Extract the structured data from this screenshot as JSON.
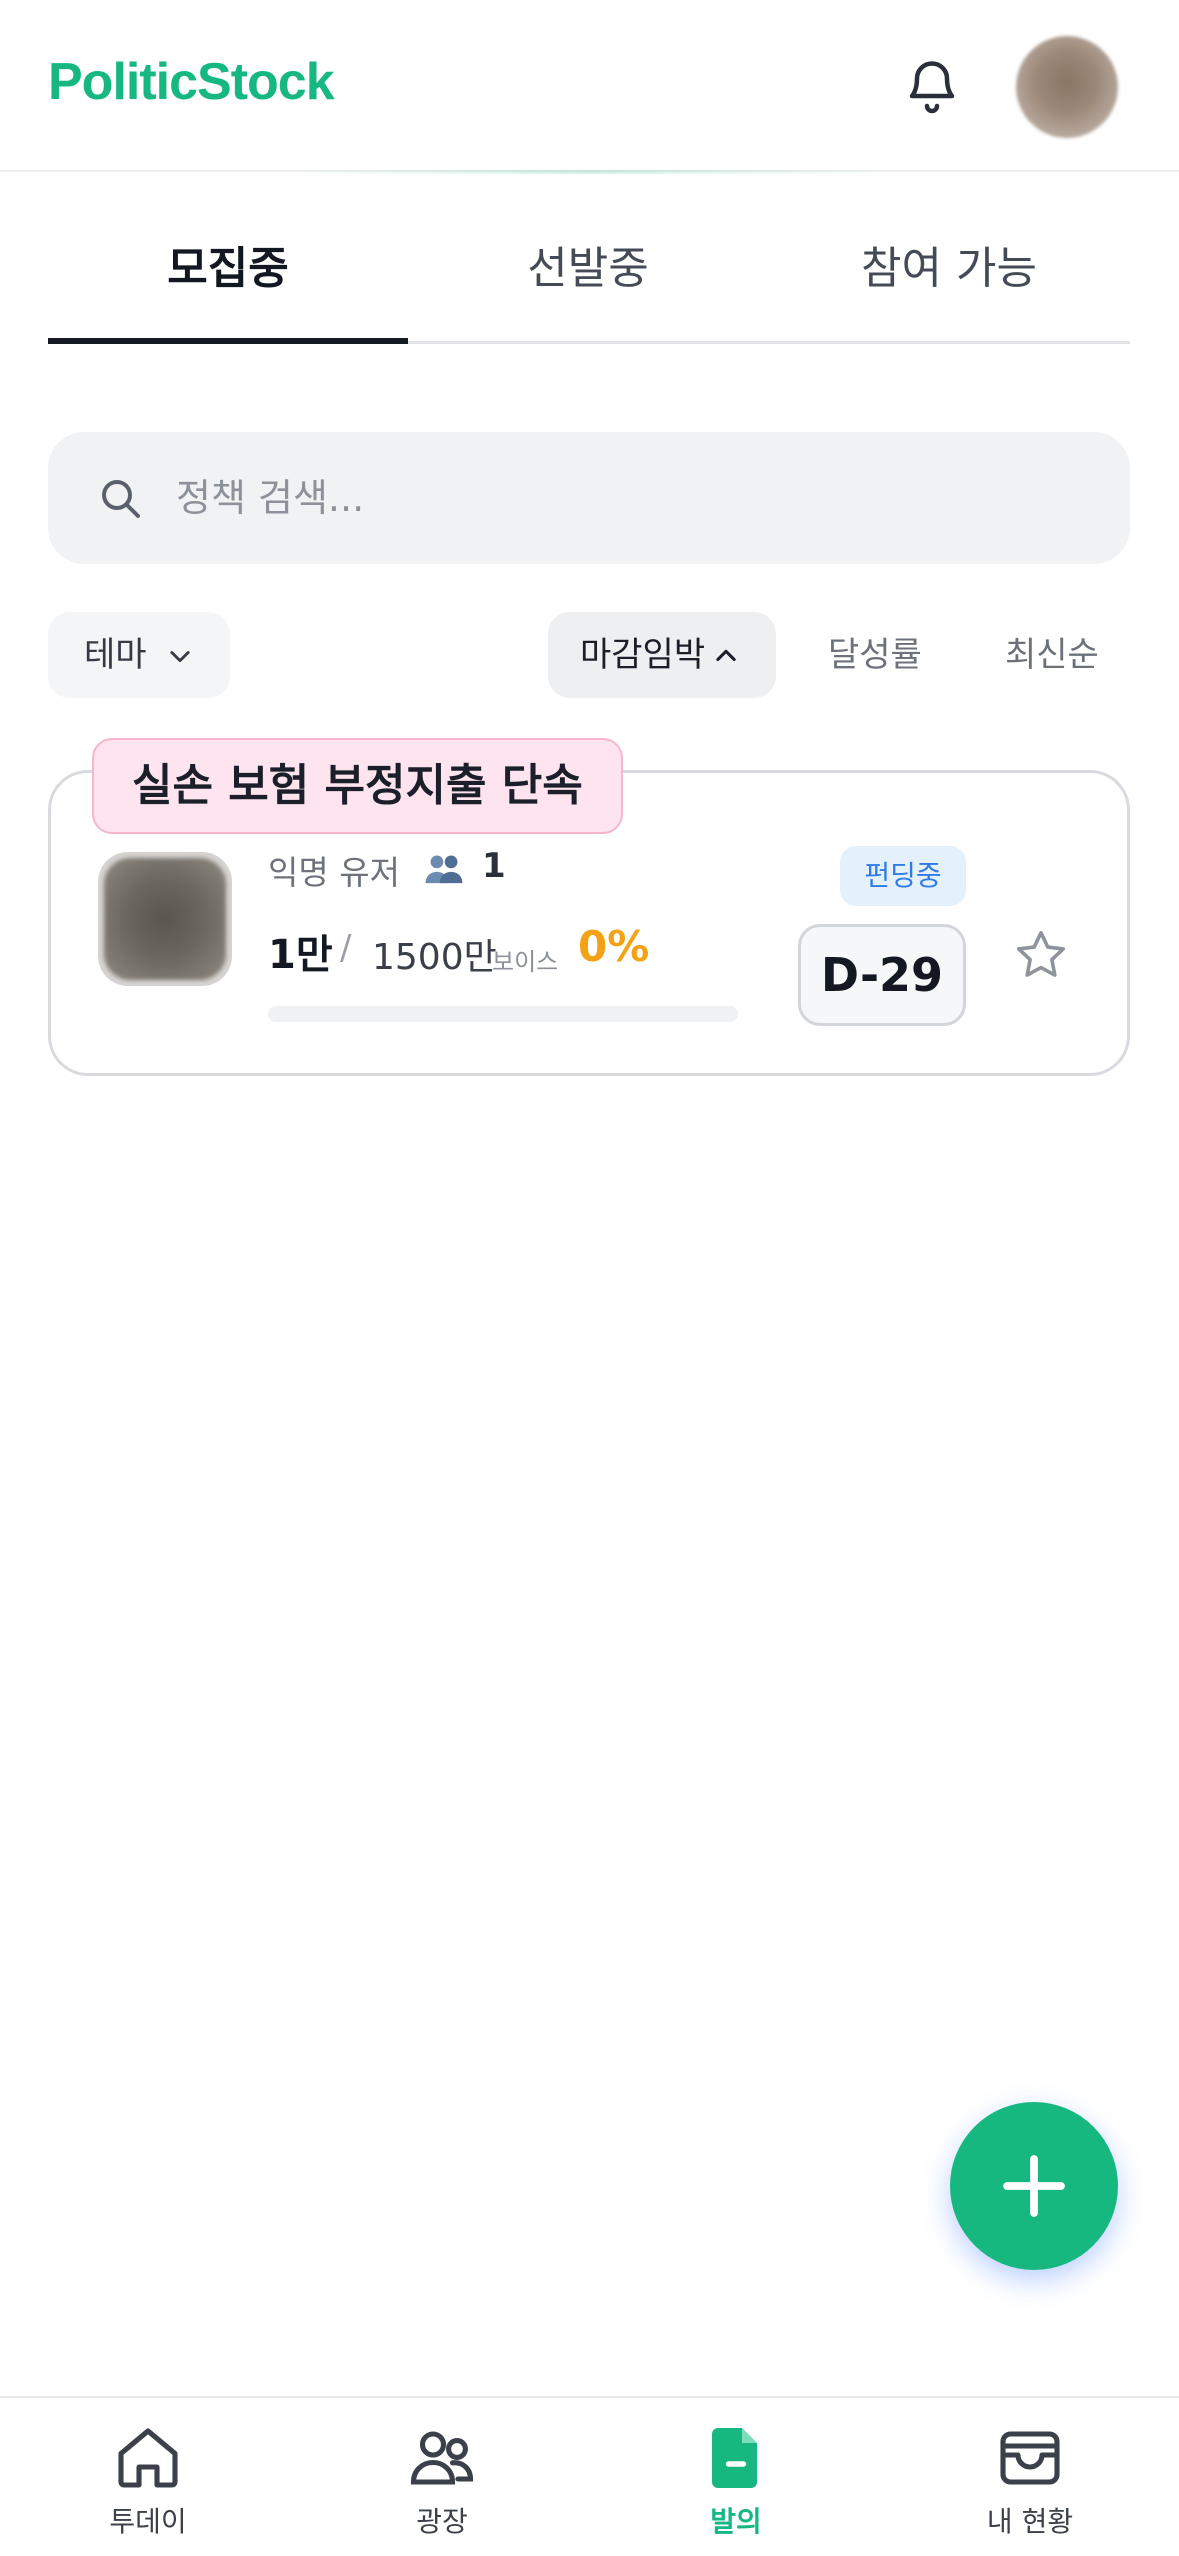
{
  "app": {
    "name": "PoliticStock"
  },
  "tabs": [
    {
      "label": "모집중",
      "active": true
    },
    {
      "label": "선발중",
      "active": false
    },
    {
      "label": "참여 가능",
      "active": false
    }
  ],
  "search": {
    "placeholder": "정책 검색..."
  },
  "filters": {
    "theme": "테마",
    "sort_options": [
      {
        "label": "마감임박",
        "selected": true
      },
      {
        "label": "달성률",
        "selected": false
      },
      {
        "label": "최신순",
        "selected": false
      }
    ]
  },
  "policies": [
    {
      "title": "실손 보험 부정지출 단속",
      "author": "익명 유저",
      "participants": "1",
      "amount": "1만",
      "goal": "1500만",
      "unit": "보이스",
      "percent_label": "0%",
      "progress": 0,
      "status": "펀딩중",
      "dday": "D-29"
    }
  ],
  "nav": [
    {
      "label": "투데이",
      "icon": "home-icon",
      "active": false
    },
    {
      "label": "광장",
      "icon": "users-icon",
      "active": false
    },
    {
      "label": "발의",
      "icon": "document-icon",
      "active": true
    },
    {
      "label": "내 현황",
      "icon": "wallet-icon",
      "active": false
    }
  ],
  "colors": {
    "brand": "#16b880",
    "accent_orange": "#f2a213",
    "status_blue": "#2f7be8",
    "tag_pink": "#fde4ee"
  }
}
